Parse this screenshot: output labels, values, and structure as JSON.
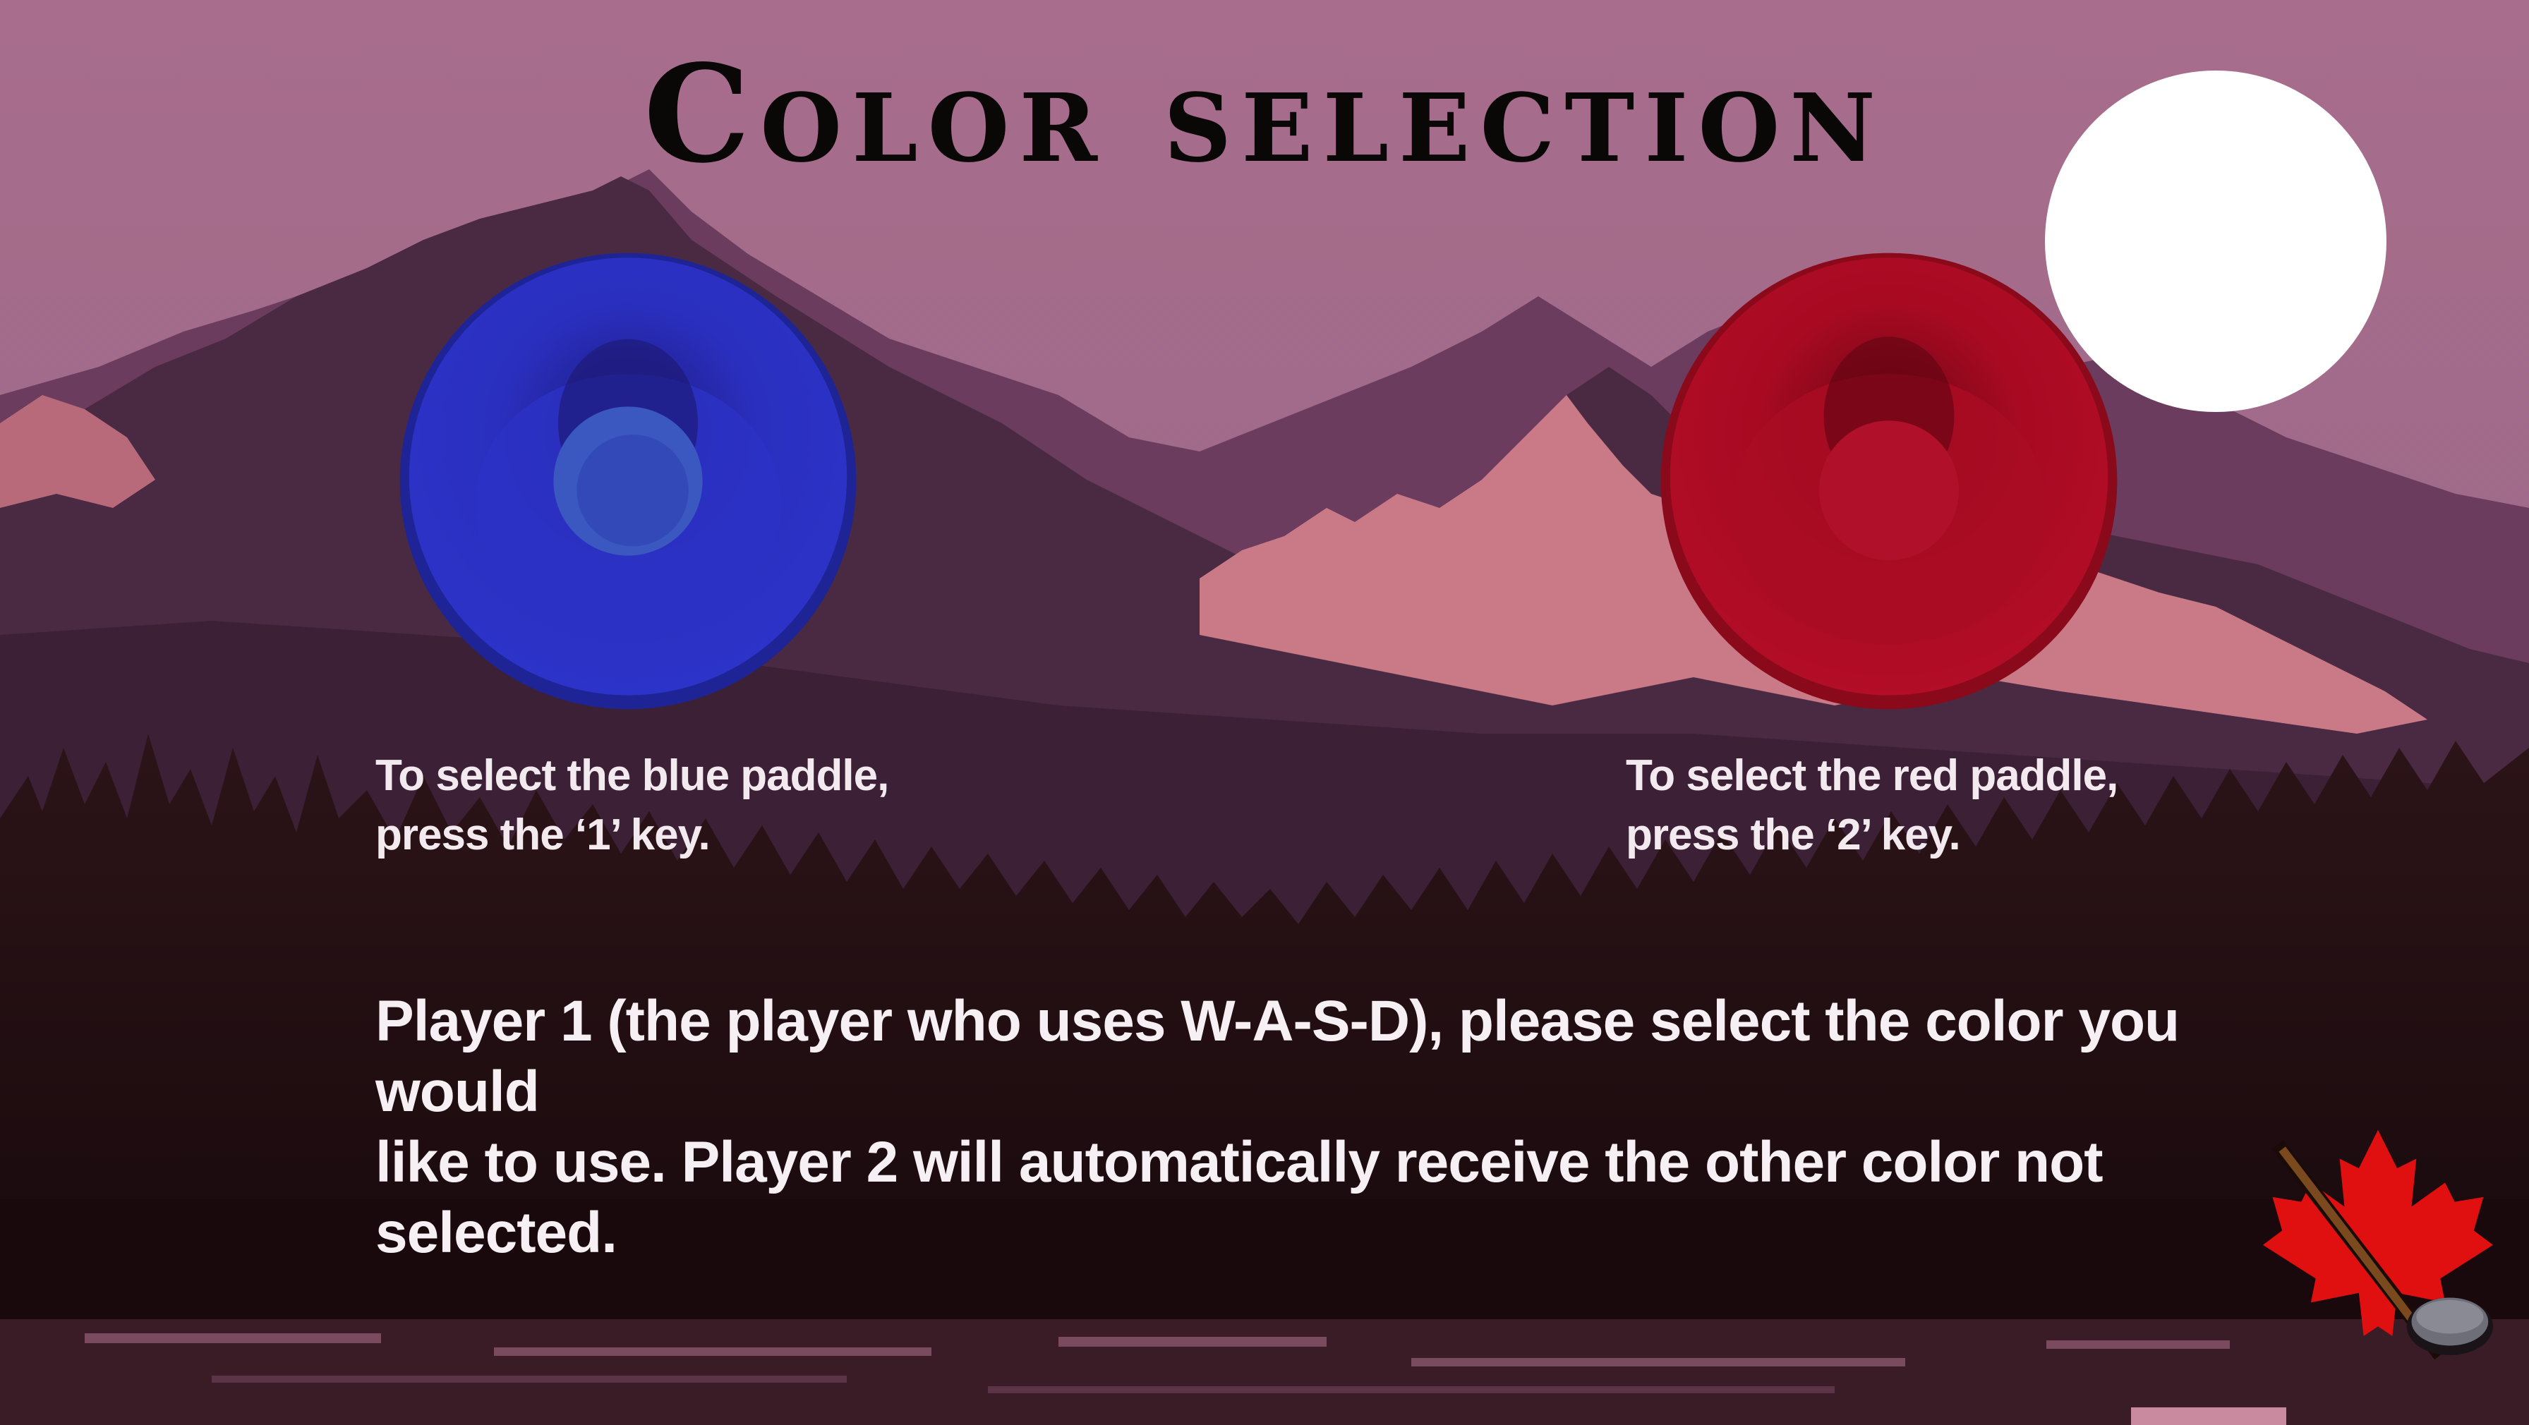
{
  "screen": {
    "title": "Color selection"
  },
  "options": [
    {
      "id": "blue",
      "color": "#2a2fbf",
      "caption_line1": "To select the blue paddle,",
      "caption_line2": "press the ‘1’ key.",
      "key": "1"
    },
    {
      "id": "red",
      "color": "#a80a22",
      "caption_line1": "To select the red paddle,",
      "caption_line2": "press the ‘2’ key.",
      "key": "2"
    }
  ],
  "instruction": {
    "line1": "Player 1 (the player who uses W-A-S-D), please select the color you would",
    "line2": "like to use. Player 2 will automatically receive the other color not selected."
  },
  "colors": {
    "sky": "#a86d8c",
    "mountain_dark": "#4a2a42",
    "mountain_pink": "#c97a86",
    "forest": "#1e0c10",
    "moon": "#ffffff",
    "text": "#f3eaf0",
    "title": "#0a0707"
  },
  "icons": {
    "logo": "maple-leaf-hockey-stick-puck-icon",
    "moon": "moon-icon"
  }
}
